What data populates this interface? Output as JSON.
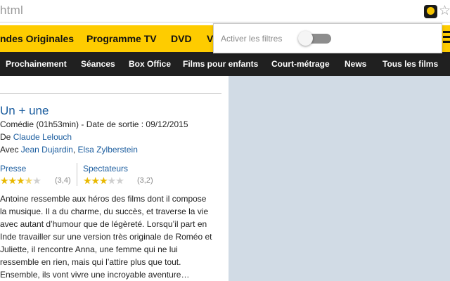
{
  "browser": {
    "url_fragment": "html"
  },
  "nav_primary": [
    "ndes Originales",
    "Programme TV",
    "DVD",
    "V"
  ],
  "nav_secondary": [
    "Prochainement",
    "Séances",
    "Box Office",
    "Films pour enfants",
    "Court-métrage",
    "News",
    "Tous les films"
  ],
  "popup": {
    "label": "Activer les filtres",
    "toggle_on": false
  },
  "movie": {
    "title": "Un + une",
    "genre_line": "Comédie (01h53min) - Date de sortie : 09/12/2015",
    "director_prefix": "De ",
    "director": "Claude Lelouch",
    "cast_prefix": "Avec ",
    "actor1": "Jean Dujardin",
    "cast_sep": ", ",
    "actor2": "Elsa Zylberstein",
    "press_label": "Presse",
    "press_rating": 3.4,
    "press_score": "(3,4)",
    "spectators_label": "Spectateurs",
    "spectators_rating": 3.2,
    "spectators_score": "(3,2)",
    "synopsis_lines": [
      "Antoine ressemble aux héros des films dont il compose",
      "la musique. Il a du charme, du succès, et traverse la vie",
      "avec autant d’humour que de légèreté. Lorsqu’il part en",
      "Inde travailler sur une version très originale de Roméo et",
      "Juliette, il rencontre Anna, une femme qui ne lui",
      "ressemble en rien, mais qui l’attire plus que tout.",
      "Ensemble, ils vont vivre une incroyable aventure…"
    ]
  },
  "colors": {
    "nav_yellow": "#fecc00",
    "nav_black": "#202020",
    "link": "#1a5c9e",
    "side_panel": "#d1dbe5"
  },
  "icons": {
    "extension": "extension-icon",
    "bookmark": "star-icon",
    "menu": "hamburger-menu-icon"
  }
}
